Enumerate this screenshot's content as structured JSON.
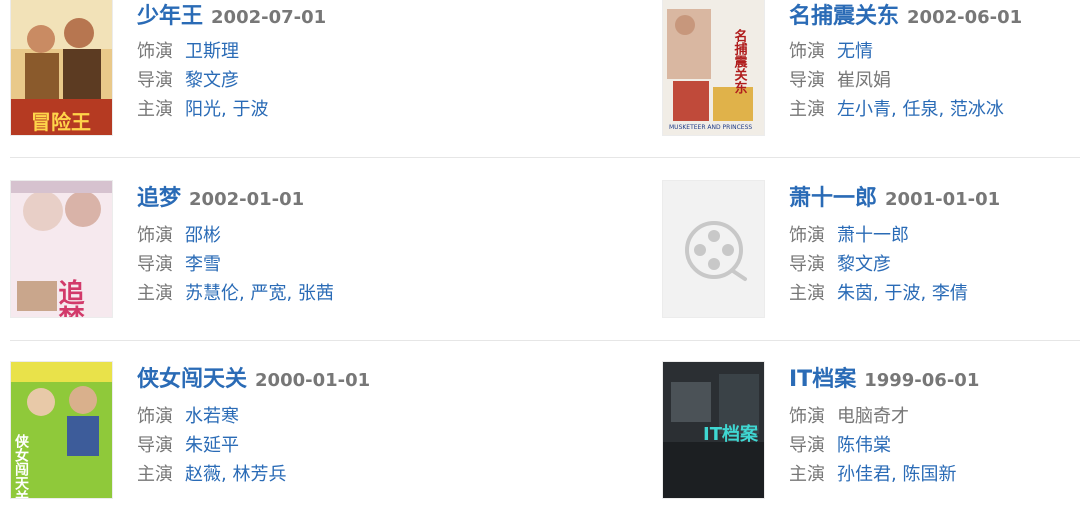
{
  "labels": {
    "role": "饰演",
    "director": "导演",
    "cast": "主演"
  },
  "entries": [
    {
      "title": "少年王",
      "date": "2002-07-01",
      "role": "卫斯理",
      "director": "黎文彦",
      "cast": [
        "阳光",
        "于波"
      ]
    },
    {
      "title": "名捕震关东",
      "date": "2002-06-01",
      "role": "无情",
      "director": "崔凤娟",
      "cast": [
        "左小青",
        "任泉",
        "范冰冰"
      ]
    },
    {
      "title": "追梦",
      "date": "2002-01-01",
      "role": "邵彬",
      "director": "李雪",
      "cast": [
        "苏慧伦",
        "严宽",
        "张茜"
      ]
    },
    {
      "title": "萧十一郎",
      "date": "2001-01-01",
      "role": "萧十一郎",
      "director": "黎文彦",
      "cast": [
        "朱茵",
        "于波",
        "李倩"
      ]
    },
    {
      "title": "侠女闯天关",
      "date": "2000-01-01",
      "role": "水若寒",
      "director": "朱延平",
      "cast": [
        "赵薇",
        "林芳兵"
      ]
    },
    {
      "title": "IT档案",
      "date": "1999-06-01",
      "role": "电脑奇才",
      "director": "陈伟棠",
      "cast": [
        "孙佳君",
        "陈国新"
      ]
    }
  ],
  "posters": {
    "p1": {
      "lines": [
        "冒险王"
      ],
      "icon": "poster-image"
    },
    "p2": {
      "lines": [
        "名捕震关东",
        "MUSKETEER AND PRINCESS"
      ],
      "icon": "poster-image"
    },
    "p3": {
      "lines": [
        "追梦"
      ],
      "icon": "poster-image"
    },
    "p4": {
      "icon": "film-reel-icon"
    },
    "p5": {
      "lines": [
        "侠女闯天关"
      ],
      "icon": "poster-image"
    },
    "p6": {
      "lines": [
        "IT档案"
      ],
      "icon": "poster-image"
    }
  },
  "colors": {
    "link": "#2a6bb6",
    "label": "#777777",
    "divider": "#e6e6e6"
  }
}
